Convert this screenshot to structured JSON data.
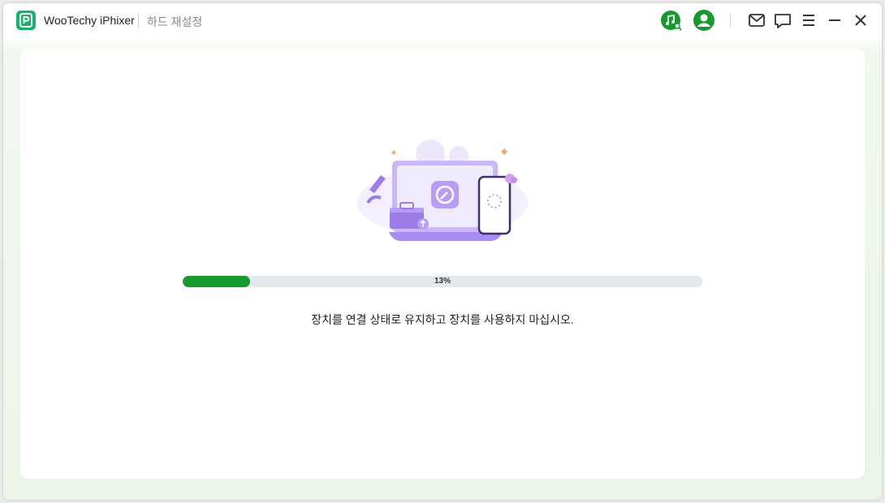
{
  "app": {
    "title": "WooTechy iPhixer",
    "subtitle": "하드 재설정"
  },
  "toolbar": {
    "icons": [
      "music-search-icon",
      "user-account-icon",
      "mail-icon",
      "feedback-icon",
      "menu-icon",
      "minimize-icon",
      "close-icon"
    ]
  },
  "progress": {
    "percent": 13,
    "label": "13%"
  },
  "message": "장치를 연결 상태로 유지하고 장치를 사용하지 마십시오.",
  "colors": {
    "accent": "#169a2e",
    "brand": "#19b26b",
    "illustration": "#a98cf0"
  }
}
